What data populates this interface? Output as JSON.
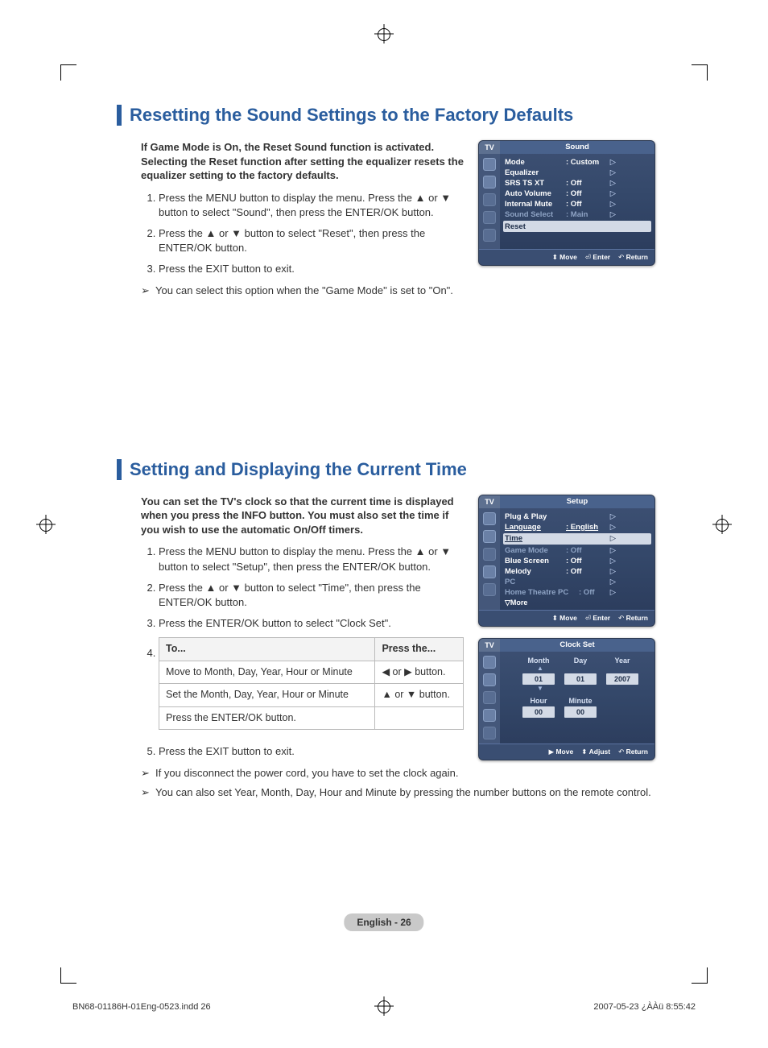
{
  "section1": {
    "title": "Resetting the Sound Settings to the Factory Defaults",
    "intro": "If Game Mode is On, the Reset Sound function is activated. Selecting the Reset function after setting the equalizer resets the equalizer setting to the factory defaults.",
    "steps": [
      "Press the MENU button to display the menu. Press the ▲ or ▼  button to select \"Sound\", then press the ENTER/OK button.",
      "Press the ▲ or ▼ button to select \"Reset\", then press the ENTER/OK button.",
      "Press the EXIT button to exit."
    ],
    "note": "You can select this option when the \"Game Mode\" is set to \"On\"."
  },
  "osd_sound": {
    "tv": "TV",
    "title": "Sound",
    "rows": [
      {
        "label": "Mode",
        "val": ": Custom",
        "tri": true
      },
      {
        "label": "Equalizer",
        "val": "",
        "tri": true
      },
      {
        "label": "SRS TS XT",
        "val": ": Off",
        "tri": true
      },
      {
        "label": "Auto Volume",
        "val": ": Off",
        "tri": true
      },
      {
        "label": "Internal Mute",
        "val": ": Off",
        "tri": true
      },
      {
        "label": "Sound Select",
        "val": ": Main",
        "tri": true,
        "dim": true
      }
    ],
    "highlight": "Reset",
    "foot": {
      "move": "Move",
      "enter": "Enter",
      "ret": "Return"
    }
  },
  "section2": {
    "title": "Setting and Displaying the Current Time",
    "intro": "You can set the TV's clock so that the current time is displayed when you press the INFO button. You must also set the time if you wish to use the automatic On/Off timers.",
    "steps": [
      "Press the MENU button to display the menu. Press the ▲ or ▼ button to select \"Setup\", then press the ENTER/OK button.",
      "Press the ▲ or ▼ button to select \"Time\", then press the ENTER/OK button.",
      "Press the ENTER/OK button to select \"Clock Set\"."
    ],
    "step4_label": "4.",
    "table": {
      "head": [
        "To...",
        "Press the..."
      ],
      "rows": [
        [
          "Move to Month, Day, Year, Hour or Minute",
          "◀  or  ▶  button."
        ],
        [
          "Set the Month, Day, Year, Hour or Minute",
          "▲  or  ▼  button."
        ],
        [
          "Press the ENTER/OK button.",
          ""
        ]
      ]
    },
    "step5": "Press the EXIT button to exit.",
    "notes": [
      "If you disconnect the power cord, you have to set the clock again.",
      "You can also set Year, Month, Day, Hour and Minute by pressing the number buttons on the remote control."
    ]
  },
  "osd_setup": {
    "tv": "TV",
    "title": "Setup",
    "rows": [
      {
        "label": "Plug & Play",
        "val": "",
        "tri": true
      },
      {
        "label": "Language",
        "val": ": English",
        "tri": true,
        "underline": true
      },
      {
        "label": "Time",
        "val": "",
        "tri": true,
        "highlight": true
      },
      {
        "label": "Game Mode",
        "val": ": Off",
        "tri": true,
        "dim": true
      },
      {
        "label": "Blue Screen",
        "val": ": Off",
        "tri": true
      },
      {
        "label": "Melody",
        "val": ": Off",
        "tri": true
      },
      {
        "label": "PC",
        "val": "",
        "tri": true,
        "dim": true
      },
      {
        "label": "Home Theatre PC",
        "val": ": Off",
        "tri": true,
        "dim": true
      }
    ],
    "more": "▽More",
    "foot": {
      "move": "Move",
      "enter": "Enter",
      "ret": "Return"
    }
  },
  "osd_clock": {
    "tv": "TV",
    "title": "Clock Set",
    "labels1": [
      "Month",
      "Day",
      "Year"
    ],
    "vals1": [
      "01",
      "01",
      "2007"
    ],
    "labels2": [
      "Hour",
      "Minute"
    ],
    "vals2": [
      "00",
      "00"
    ],
    "foot": {
      "move": "Move",
      "adjust": "Adjust",
      "ret": "Return"
    }
  },
  "footer": {
    "page": "English - 26",
    "left": "BN68-01186H-01Eng-0523.indd   26",
    "right": "2007-05-23   ¿ÀÀü 8:55:42"
  }
}
